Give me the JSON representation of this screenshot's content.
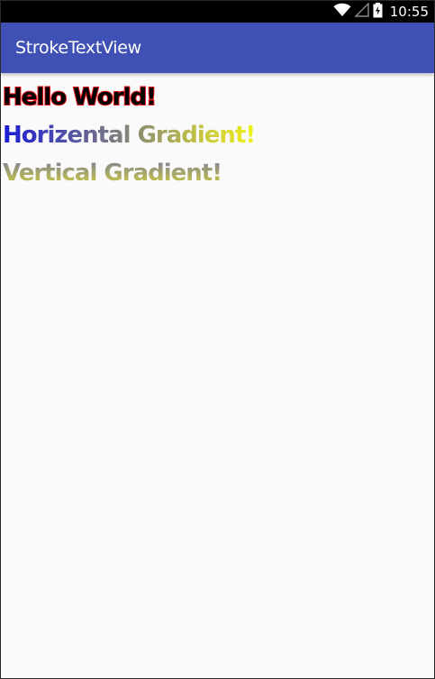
{
  "status_bar": {
    "time": "10:55",
    "icons": [
      "wifi-icon",
      "cell-signal-icon",
      "battery-charging-icon"
    ],
    "background_color": "#000000"
  },
  "app_bar": {
    "title": "StrokeTextView",
    "background_color": "#3f51b5"
  },
  "content": {
    "lines": [
      {
        "text": "Hello World!",
        "style": "stroke",
        "fill_color": "#000000",
        "stroke_color": "#e8141b"
      },
      {
        "text": "Horizental Gradient!",
        "style": "horizontal-gradient",
        "gradient_colors": [
          "#1a1ad6",
          "#f2f21a"
        ]
      },
      {
        "text": "Vertical Gradient!",
        "style": "vertical-gradient",
        "gradient_colors": [
          "#6e6ea8",
          "#e0e02a"
        ]
      }
    ]
  }
}
